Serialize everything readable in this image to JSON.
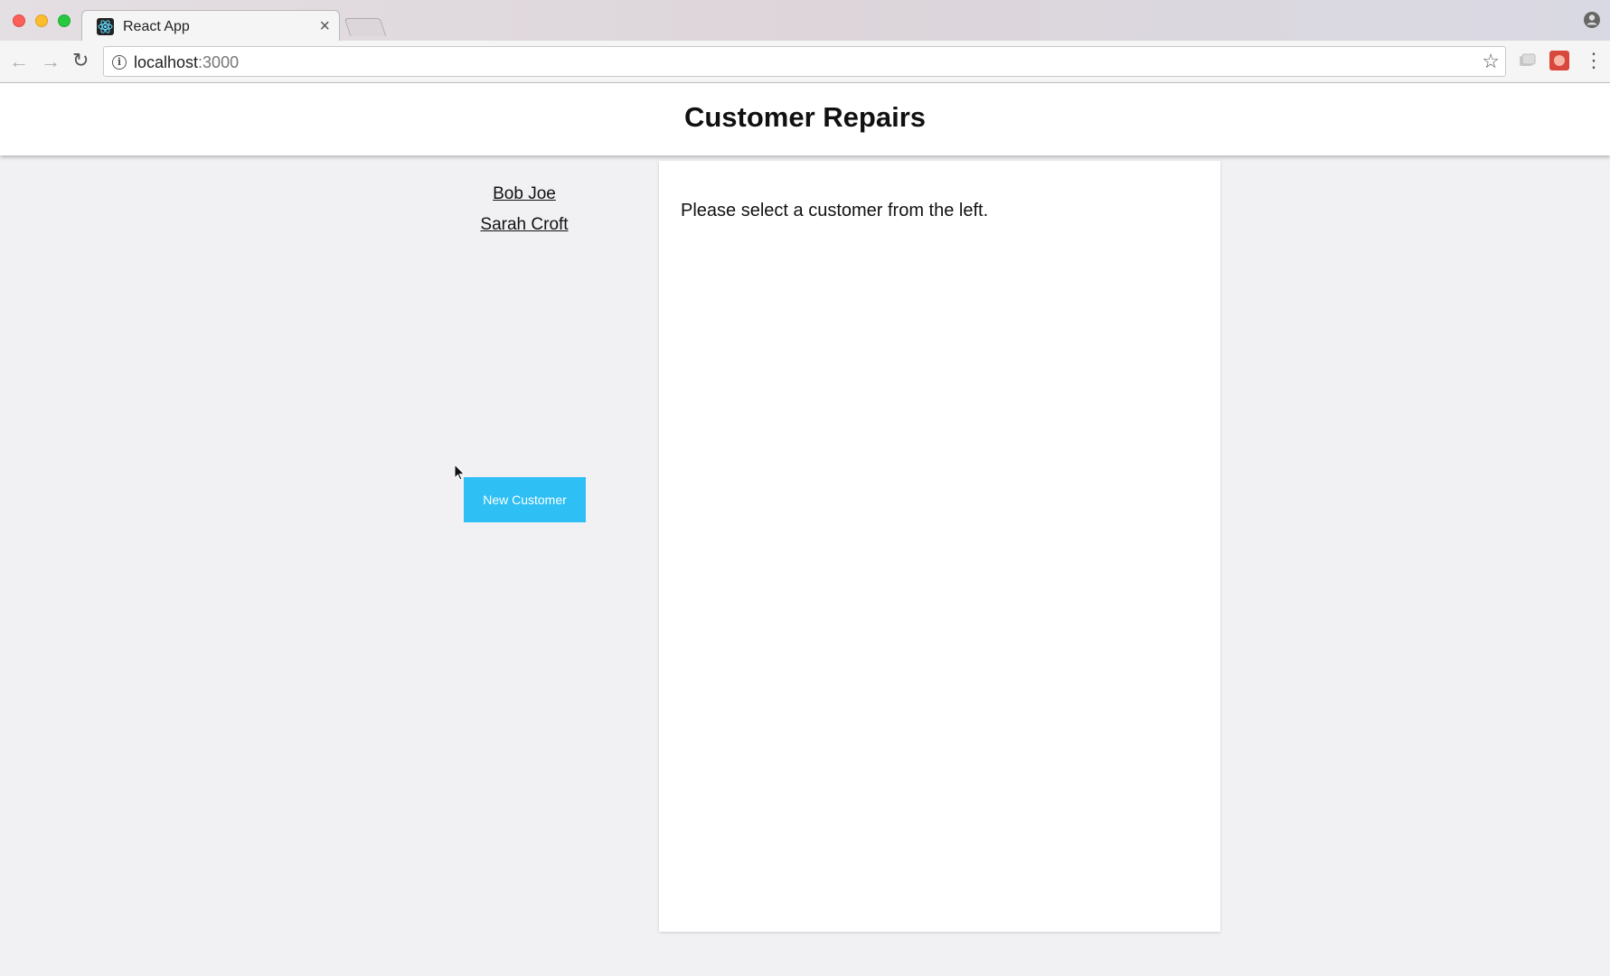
{
  "browser": {
    "tab_title": "React App",
    "tab_close": "×",
    "url_host": "localhost",
    "url_port": ":3000",
    "icons": [
      "react-favicon",
      "back-arrow",
      "forward-arrow",
      "reload",
      "info",
      "star",
      "extension",
      "menu",
      "profile"
    ]
  },
  "app": {
    "title": "Customer Repairs"
  },
  "customers": [
    {
      "name": "Bob Joe"
    },
    {
      "name": "Sarah Croft"
    }
  ],
  "buttons": {
    "new_customer": "New Customer"
  },
  "detail": {
    "message": "Please select a customer from the left."
  },
  "colors": {
    "button": "#2ebff4",
    "page_bg": "#f1f1f4",
    "panel_bg": "#ffffff"
  }
}
